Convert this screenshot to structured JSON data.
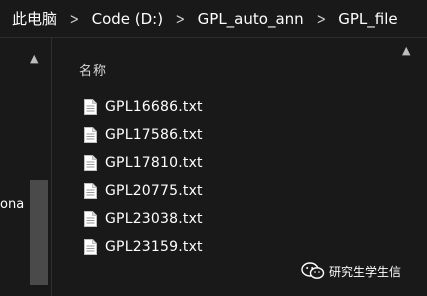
{
  "breadcrumb": [
    "此电脑",
    "Code (D:)",
    "GPL_auto_ann",
    "GPL_file"
  ],
  "breadcrumb_separator_icon": "chevron-right-icon",
  "column_header": "名称",
  "files": [
    {
      "name": "GPL16686.txt",
      "icon": "text-file-icon"
    },
    {
      "name": "GPL17586.txt",
      "icon": "text-file-icon"
    },
    {
      "name": "GPL17810.txt",
      "icon": "text-file-icon"
    },
    {
      "name": "GPL20775.txt",
      "icon": "text-file-icon"
    },
    {
      "name": "GPL23038.txt",
      "icon": "text-file-icon"
    },
    {
      "name": "GPL23159.txt",
      "icon": "text-file-icon"
    }
  ],
  "left_pane": {
    "partial_text": "ona"
  },
  "watermark": {
    "text": "研究生学生信",
    "icon": "wechat-icon"
  },
  "colors": {
    "background": "#191919",
    "text": "#ffffff",
    "scrollbar_thumb": "#4a4a4a"
  }
}
